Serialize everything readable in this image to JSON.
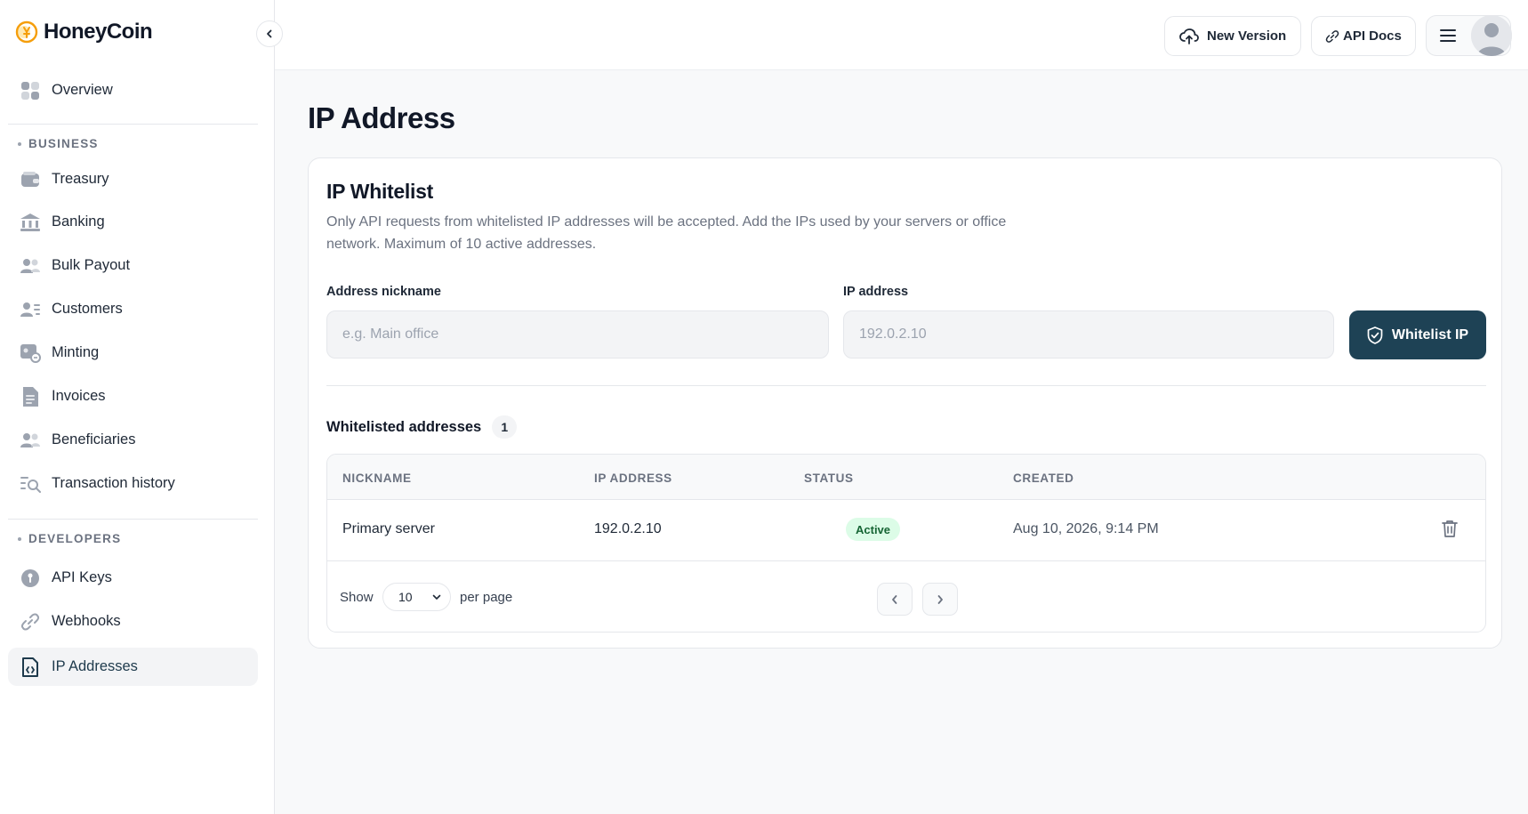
{
  "brand": {
    "name": "HoneyCoin",
    "accent": "#f59e0b"
  },
  "sidebar": {
    "overview": "Overview",
    "sections": [
      {
        "label": "BUSINESS"
      },
      {
        "label": "DEVELOPERS"
      }
    ],
    "items": [
      {
        "label": "Treasury",
        "icon": "wallet-icon"
      },
      {
        "label": "Banking",
        "icon": "bank-icon"
      },
      {
        "label": "Bulk Payout",
        "icon": "users-icon"
      },
      {
        "label": "Customers",
        "icon": "customers-icon"
      },
      {
        "label": "Minting",
        "icon": "minting-icon"
      },
      {
        "label": "Invoices",
        "icon": "invoice-icon"
      },
      {
        "label": "Beneficiaries",
        "icon": "beneficiaries-icon"
      },
      {
        "label": "Transaction history",
        "icon": "transaction-search-icon"
      },
      {
        "label": "API Keys",
        "icon": "key-icon"
      },
      {
        "label": "Webhooks",
        "icon": "link-icon"
      },
      {
        "label": "IP Addresses",
        "icon": "ip-address-icon",
        "active": true
      }
    ]
  },
  "header": {
    "new_version": "New Version",
    "api_docs": "API Docs"
  },
  "page": {
    "title": "IP Address"
  },
  "whitelist": {
    "title": "IP Whitelist",
    "description": "Only API requests from whitelisted IP addresses will be accepted. Add the IPs used by your servers or office network. Maximum of 10 active addresses.",
    "nickname_label": "Address nickname",
    "nickname_placeholder": "e.g. Main office",
    "ip_label": "IP address",
    "ip_placeholder": "192.0.2.10",
    "button": "Whitelist IP",
    "button_color": "#1e4255"
  },
  "list": {
    "title": "Whitelisted addresses",
    "count": "1",
    "columns": [
      "NICKNAME",
      "IP ADDRESS",
      "STATUS",
      "CREATED"
    ],
    "rows": [
      {
        "nickname": "Primary server",
        "ip": "192.0.2.10",
        "status": "Active",
        "created": "Aug 10, 2026, 9:14 PM"
      }
    ],
    "show_label": "Show",
    "per_page_value": "10",
    "per_page_label": "per page"
  }
}
